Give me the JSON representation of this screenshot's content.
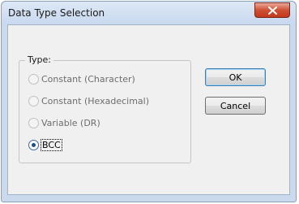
{
  "dialog": {
    "title": "Data Type Selection",
    "close_icon": "close-x-icon"
  },
  "type_group": {
    "label": "Type:",
    "options": [
      {
        "label": "Constant (Character)",
        "enabled": false,
        "checked": false
      },
      {
        "label": "Constant (Hexadecimal)",
        "enabled": false,
        "checked": false
      },
      {
        "label": "Variable (DR)",
        "enabled": false,
        "checked": false
      },
      {
        "label": "BCC",
        "enabled": true,
        "checked": true
      }
    ]
  },
  "buttons": {
    "ok": "OK",
    "cancel": "Cancel"
  },
  "colors": {
    "close_button": "#cf4f33",
    "frame": "#cad9ec",
    "client_bg": "#f0f0f0"
  }
}
